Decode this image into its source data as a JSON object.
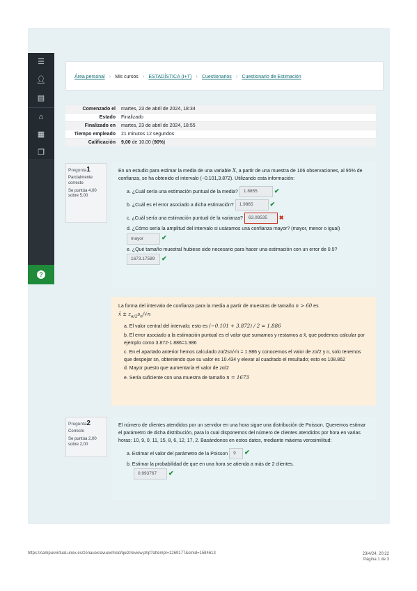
{
  "nav": {
    "items": [
      "menu-icon",
      "user-icon",
      "courses-icon",
      "home-icon",
      "calendar-icon",
      "files-icon",
      "help-icon"
    ]
  },
  "breadcrumb": {
    "items": [
      "Área personal",
      "Mis cursos",
      "ESTADÍSTICA (I+T)",
      "Cuestionarios",
      "Cuestionario de Estimación"
    ]
  },
  "summary": [
    {
      "key": "Comenzado el",
      "value": "martes, 23 de abril de 2024, 18:34"
    },
    {
      "key": "Estado",
      "value": "Finalizado"
    },
    {
      "key": "Finalizado en",
      "value": "martes, 23 de abril de 2024, 18:55"
    },
    {
      "key": "Tiempo empleado",
      "value": "21 minutos 12 segundos"
    },
    {
      "key": "Calificación",
      "value_bold": "9,00",
      "value_mid": " de 10,00 (",
      "value_pct": "90%",
      "value_end": ")"
    }
  ],
  "q1": {
    "label": "Pregunta",
    "number": "1",
    "state": "Parcialmente correcto",
    "score": "Se puntúa 4,00 sobre 5,00",
    "text_a": "En un estudio para estimar la media de una variable ",
    "text_var": "X",
    "text_b": ", a partir de una muestra de 106 observaciones, al 95% de confianza, se ha obtenido el intervalo (−0.101,3.872). Utilizando esta información:",
    "items": [
      {
        "letter": "a.",
        "text": "¿Cuál sería una estimación puntual de la media?",
        "answer": "1.8855",
        "status": "correct"
      },
      {
        "letter": "b.",
        "text": "¿Cuál es el error asociado a dicha estimación?",
        "answer": "1.9865",
        "status": "correct"
      },
      {
        "letter": "c.",
        "text": "¿Cuál sería una estimación puntual de la varianza?",
        "answer": "63.08535",
        "status": "incorrect"
      },
      {
        "letter": "d.",
        "text": "¿Cómo sería la amplitud del intervalo si usáramos una confianza mayor? (mayor, menor o igual)",
        "answer": "mayor",
        "status": "correct"
      },
      {
        "letter": "e.",
        "text": "¿Qué tamaño muestral hubiese sido necesario para hacer una estimación con un error de 0.5?",
        "answer": "1673.17589",
        "status": "correct"
      }
    ]
  },
  "feedback": {
    "intro": "La forma del intervalo de confianza para la media a partir de muestras de tamaño",
    "intro_cond": "n > 60",
    "intro_es": "es",
    "intro_formula": "x̄ ± z",
    "intro_formula_sub": "α/2",
    "intro_formula_rest": "s",
    "intro_formula_sub2": "n",
    "intro_formula_end": "/√n",
    "items": [
      {
        "letter": "a.",
        "text": "El valor central del intervalo; esto es",
        "math": "(−0.101 + 3.872) / 2 = 1.886"
      },
      {
        "letter": "b.",
        "text": "El error asociado a la estimación puntual es el valor que sumamos y restamos a x̄, que podemos calcular por ejemplo como 3.872-1.886=1.986",
        "math": ""
      },
      {
        "letter": "c.",
        "text": "En el apartado anterior hemos calculado zα/2sn/√n = 1.986 y conocemos el valor de zα/2 y n, solo tenemos que despejar sn, obteniendo que su valor es 10.434 y elevar al cuadrado el resultado; esto es 108.862",
        "math": ""
      },
      {
        "letter": "d.",
        "text": "Mayor puesto que aumentaría el valor de zα/2",
        "math": ""
      },
      {
        "letter": "e.",
        "text": "Sería suficiente con una muestra de tamaño",
        "math": "n = 1673"
      }
    ]
  },
  "q2": {
    "label": "Pregunta",
    "number": "2",
    "state": "Correcto",
    "score": "Se puntúa 2,00 sobre 2,00",
    "text": "El número de clientes atendidos por un servidor en una hora sigue una distribución de Poisson. Queremos estimar el parámetro de dicha distribución, para lo cual disponemos del número de clientes atendidos por hora en varias horas: 10, 9, 0, 11, 15, 8, 6, 12, 17, 2. Basándonos en estos datos, mediante máxima verosimilitud:",
    "items": [
      {
        "letter": "a.",
        "text": "Estimar el valor del parámetro de la Poisson",
        "answer": "9",
        "status": "correct"
      },
      {
        "letter": "b.",
        "text": "Estimar la probabilidad de que en una hora se atienda a más de 2 clientes.",
        "answer": "0.993767",
        "status": "correct"
      }
    ]
  },
  "footer": {
    "url": "https://campusvirtual.unex.es/zonauex/avuex/mod/quiz/review.php?attempt=1269177&cmid=1584613",
    "datetime": "23/4/24, 20:22",
    "page": "Página 1 de 3"
  },
  "colors": {
    "accent": "#0f6e75",
    "correct": "#1f8a3a",
    "incorrect": "#ca3120",
    "question_bg": "#e7f3f5",
    "feedback_bg": "#fcefdc",
    "nav_bg": "#232a30"
  }
}
